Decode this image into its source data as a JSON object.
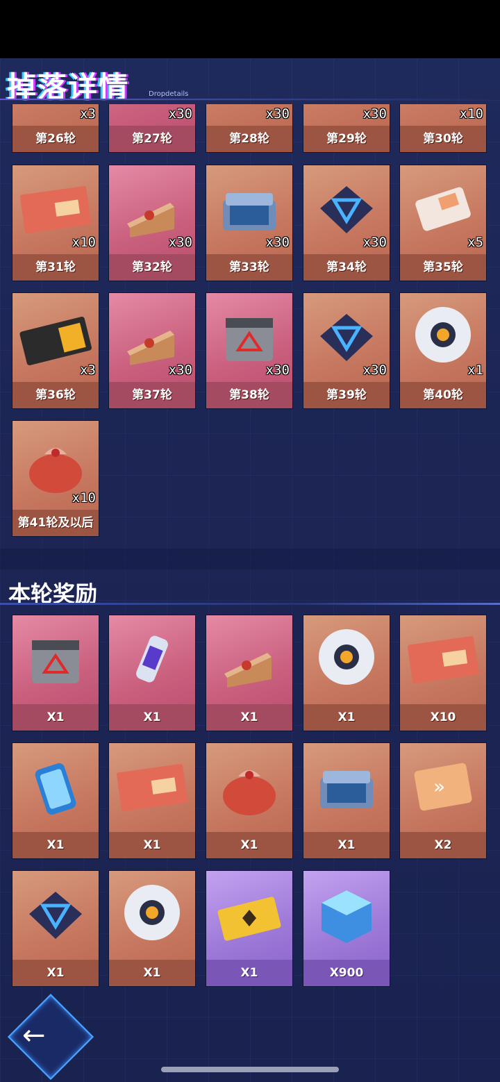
{
  "header": {
    "title": "掉落详情",
    "subtitle": "Dropdetails"
  },
  "drop_rounds": [
    {
      "label": "第26轮",
      "qty": "x3",
      "bg": "orange",
      "icon": "item-icon"
    },
    {
      "label": "第27轮",
      "qty": "x30",
      "bg": "pink",
      "icon": "item-icon"
    },
    {
      "label": "第28轮",
      "qty": "x30",
      "bg": "orange",
      "icon": "item-icon"
    },
    {
      "label": "第29轮",
      "qty": "x30",
      "bg": "orange",
      "icon": "item-icon"
    },
    {
      "label": "第30轮",
      "qty": "x10",
      "bg": "orange",
      "icon": "item-icon"
    },
    {
      "label": "第31轮",
      "qty": "x10",
      "bg": "orange",
      "icon": "gacha-ticket-icon"
    },
    {
      "label": "第32轮",
      "qty": "x30",
      "bg": "pink",
      "icon": "cake-icon"
    },
    {
      "label": "第33轮",
      "qty": "x30",
      "bg": "orange",
      "icon": "supply-case-icon"
    },
    {
      "label": "第34轮",
      "qty": "x30",
      "bg": "orange",
      "icon": "triangle-core-icon"
    },
    {
      "label": "第35轮",
      "qty": "x5",
      "bg": "orange",
      "icon": "ticket-icon"
    },
    {
      "label": "第36轮",
      "qty": "x3",
      "bg": "orange",
      "icon": "card-icon"
    },
    {
      "label": "第37轮",
      "qty": "x30",
      "bg": "pink",
      "icon": "cake-icon"
    },
    {
      "label": "第38轮",
      "qty": "x30",
      "bg": "pink",
      "icon": "cube-box-icon"
    },
    {
      "label": "第39轮",
      "qty": "x30",
      "bg": "orange",
      "icon": "triangle-core-icon"
    },
    {
      "label": "第40轮",
      "qty": "x1",
      "bg": "orange",
      "icon": "mech-icon"
    },
    {
      "label": "第41轮及以后",
      "qty": "x10",
      "bg": "orange",
      "icon": "lucky-bag-icon"
    }
  ],
  "section": {
    "title": "本轮奖励"
  },
  "rewards": [
    {
      "qty": "X1",
      "bg": "pink",
      "icon": "cube-box-icon"
    },
    {
      "qty": "X1",
      "bg": "pink",
      "icon": "energy-can-icon"
    },
    {
      "qty": "X1",
      "bg": "pink",
      "icon": "cake-icon"
    },
    {
      "qty": "X1",
      "bg": "orange",
      "icon": "mech-icon"
    },
    {
      "qty": "X10",
      "bg": "orange",
      "icon": "gacha-ticket-icon"
    },
    {
      "qty": "X1",
      "bg": "orange",
      "icon": "battery-icon"
    },
    {
      "qty": "X1",
      "bg": "orange",
      "icon": "gacha-ticket-icon"
    },
    {
      "qty": "X1",
      "bg": "orange",
      "icon": "lucky-bag-icon"
    },
    {
      "qty": "X1",
      "bg": "orange",
      "icon": "supply-case-icon"
    },
    {
      "qty": "X2",
      "bg": "orange",
      "icon": "speed-card-icon"
    },
    {
      "qty": "X1",
      "bg": "orange",
      "icon": "triangle-core-icon"
    },
    {
      "qty": "X1",
      "bg": "orange",
      "icon": "mech-icon"
    },
    {
      "qty": "X1",
      "bg": "purple",
      "icon": "gold-card-icon"
    },
    {
      "qty": "X900",
      "bg": "purple",
      "icon": "crystal-cube-icon"
    }
  ],
  "colors": {
    "accent": "#4aa3ff",
    "panel": "#1c2554"
  }
}
